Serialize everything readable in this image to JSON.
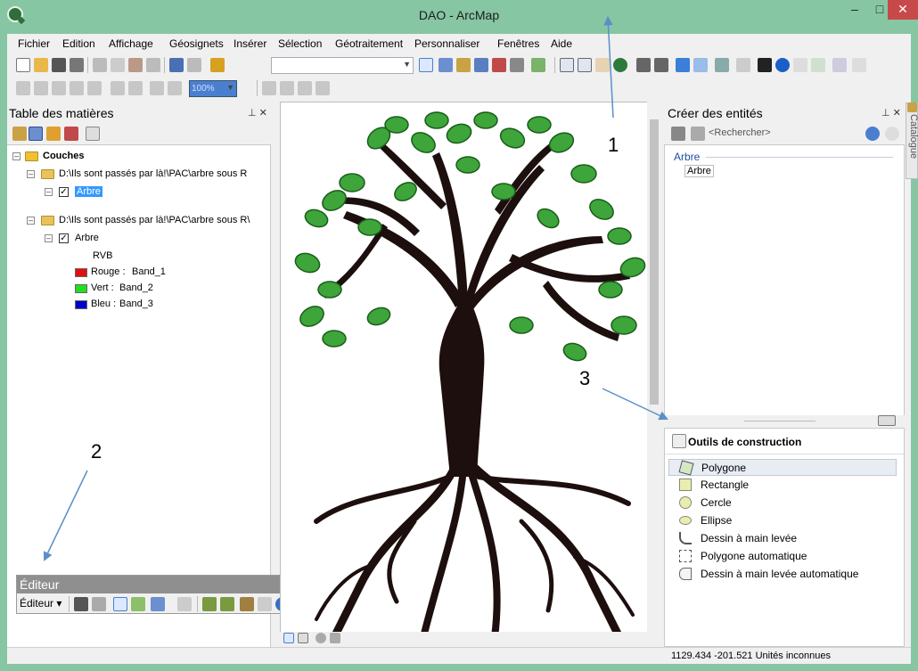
{
  "window": {
    "title": "DAO - ArcMap",
    "min": "–",
    "max": "□",
    "close": "✕"
  },
  "menu": [
    "Fichier",
    "Edition",
    "Affichage",
    "Géosignets",
    "Insérer",
    "Sélection",
    "Géotraitement",
    "Personnaliser",
    "Fenêtres",
    "Aide"
  ],
  "toolbar": {
    "scale_combo": "",
    "zoom_combo": "100%"
  },
  "toc": {
    "title": "Table des matières",
    "pin": "⊥ ✕",
    "root": "Couches",
    "group1_path": "D:\\Ils sont passés par là!\\PAC\\arbre sous R",
    "group1_layer": "Arbre",
    "group2_path": "D:\\Ils sont passés par là!\\PAC\\arbre sous R\\",
    "group2_layer": "Arbre",
    "rvb": "RVB",
    "bands": [
      {
        "label": "Rouge :",
        "value": "Band_1",
        "color": "#e01010"
      },
      {
        "label": "Vert :",
        "value": "Band_2",
        "color": "#22dd22"
      },
      {
        "label": "Bleu :",
        "value": "Band_3",
        "color": "#0000cc"
      }
    ]
  },
  "editor": {
    "title": "Éditeur",
    "menu": "Éditeur ▾",
    "close": "▾ ✕"
  },
  "create": {
    "title": "Créer des entités",
    "pin": "⊥ ✕",
    "search_placeholder": "<Rechercher>",
    "group": "Arbre",
    "item": "Arbre"
  },
  "construct": {
    "title": "Outils de construction",
    "tools": [
      "Polygone",
      "Rectangle",
      "Cercle",
      "Ellipse",
      "Dessin à main levée",
      "Polygone automatique",
      "Dessin à main levée automatique"
    ]
  },
  "catalog": "Catalogue",
  "status": {
    "coords": "1129.434  -201.521 Unités inconnues"
  },
  "annotations": {
    "a1": "1",
    "a2": "2",
    "a3": "3"
  }
}
